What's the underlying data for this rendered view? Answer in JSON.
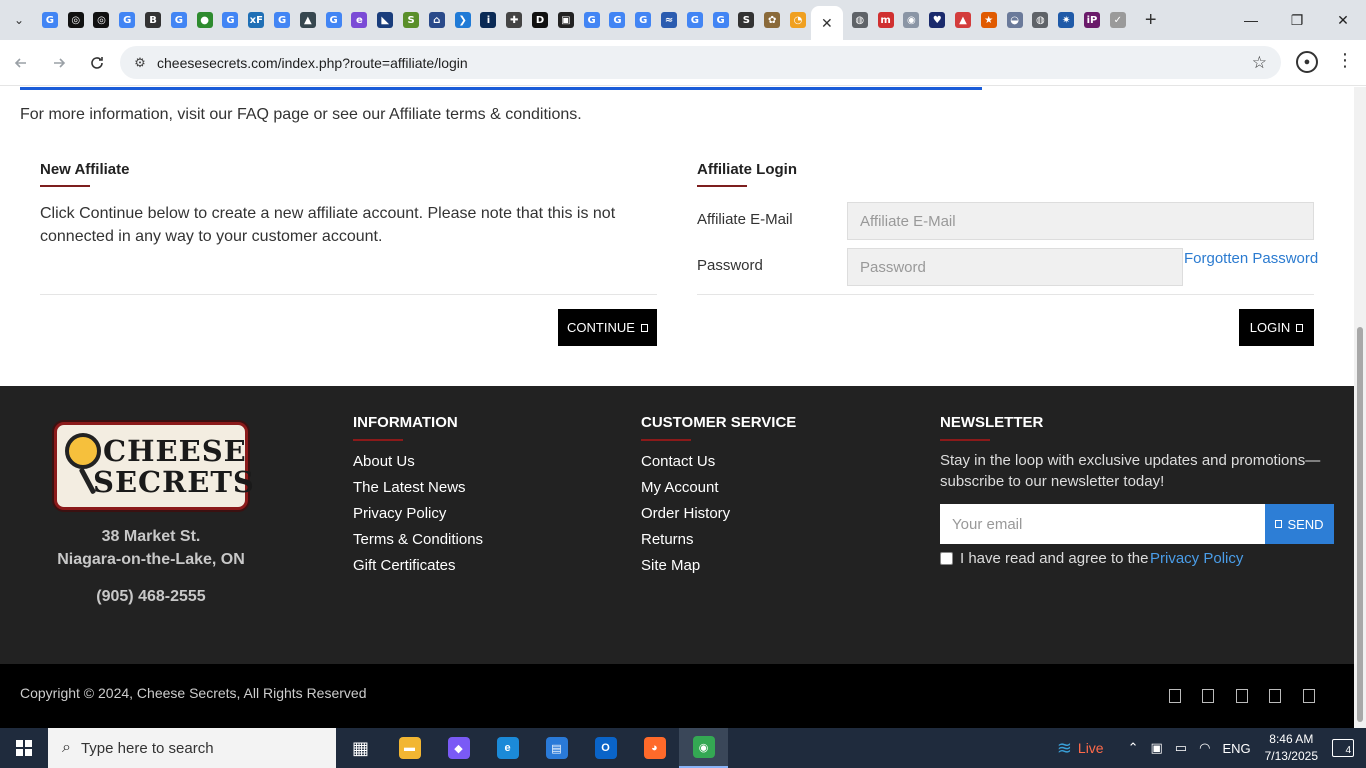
{
  "browser": {
    "url": "cheesesecrets.com/index.php?route=affiliate/login",
    "tab_close": "✕",
    "new_tab": "+",
    "window_controls": {
      "minimize": "—",
      "restore": "❐",
      "close": "✕"
    },
    "tab_favicons": [
      {
        "icon": "google-icon",
        "glyph": "G",
        "color": "#4285f4"
      },
      {
        "icon": "openai-icon",
        "glyph": "◎",
        "color": "#111111"
      },
      {
        "icon": "openai-icon",
        "glyph": "◎",
        "color": "#111111"
      },
      {
        "icon": "google-icon",
        "glyph": "G",
        "color": "#4285f4"
      },
      {
        "icon": "b-icon",
        "glyph": "B",
        "color": "#333333"
      },
      {
        "icon": "google-icon",
        "glyph": "G",
        "color": "#4285f4"
      },
      {
        "icon": "globe-icon",
        "glyph": "●",
        "color": "#2e8b2e"
      },
      {
        "icon": "google-icon",
        "glyph": "G",
        "color": "#4285f4"
      },
      {
        "icon": "xf-icon",
        "glyph": "xF",
        "color": "#1f6fb5"
      },
      {
        "icon": "google-icon",
        "glyph": "G",
        "color": "#4285f4"
      },
      {
        "icon": "cap-icon",
        "glyph": "▲",
        "color": "#37474f"
      },
      {
        "icon": "google-icon",
        "glyph": "G",
        "color": "#4285f4"
      },
      {
        "icon": "e-icon",
        "glyph": "e",
        "color": "#7b4bd6"
      },
      {
        "icon": "chart-icon",
        "glyph": "◣",
        "color": "#1a3d7c"
      },
      {
        "icon": "smart-icon",
        "glyph": "S",
        "color": "#5a8f2a"
      },
      {
        "icon": "bank-icon",
        "glyph": "⌂",
        "color": "#2a4a8a"
      },
      {
        "icon": "bird-icon",
        "glyph": "❯",
        "color": "#1f7ad6"
      },
      {
        "icon": "ibm-icon",
        "glyph": "i",
        "color": "#0a2a55"
      },
      {
        "icon": "caduceus-icon",
        "glyph": "✚",
        "color": "#444444"
      },
      {
        "icon": "dictionary-icon",
        "glyph": "D",
        "color": "#111111"
      },
      {
        "icon": "box-icon",
        "glyph": "▣",
        "color": "#222222"
      },
      {
        "icon": "google-icon",
        "glyph": "G",
        "color": "#4285f4"
      },
      {
        "icon": "google-icon",
        "glyph": "G",
        "color": "#4285f4"
      },
      {
        "icon": "google-icon",
        "glyph": "G",
        "color": "#4285f4"
      },
      {
        "icon": "wave-icon",
        "glyph": "≈",
        "color": "#2b5cb0"
      },
      {
        "icon": "google-icon",
        "glyph": "G",
        "color": "#4285f4"
      },
      {
        "icon": "google-icon",
        "glyph": "G",
        "color": "#4285f4"
      },
      {
        "icon": "sig-icon",
        "glyph": "S",
        "color": "#333333"
      },
      {
        "icon": "pattern-icon",
        "glyph": "✿",
        "color": "#8a6a3a"
      },
      {
        "icon": "cheese-icon",
        "glyph": "◔",
        "color": "#f0a020"
      }
    ],
    "tab_favicons_right": [
      {
        "icon": "globe-icon",
        "glyph": "◍",
        "color": "#5f6368"
      },
      {
        "icon": "m-icon",
        "glyph": "m",
        "color": "#d03030"
      },
      {
        "icon": "helmet-icon",
        "glyph": "◉",
        "color": "#8a95a5"
      },
      {
        "icon": "shield-icon",
        "glyph": "♥",
        "color": "#1a2a6c"
      },
      {
        "icon": "santa-icon",
        "glyph": "▲",
        "color": "#d33c3c"
      },
      {
        "icon": "badge-icon",
        "glyph": "★",
        "color": "#e05a00"
      },
      {
        "icon": "car-icon",
        "glyph": "◒",
        "color": "#6a7a9a"
      },
      {
        "icon": "globe-icon",
        "glyph": "◍",
        "color": "#5f6368"
      },
      {
        "icon": "gear-icon",
        "glyph": "✷",
        "color": "#1f5aa8"
      },
      {
        "icon": "ip-icon",
        "glyph": "iP",
        "color": "#6a1a6a"
      },
      {
        "icon": "check-icon",
        "glyph": "✓",
        "color": "#9a9a9a"
      }
    ]
  },
  "page": {
    "info_text": "For more information, visit our FAQ page or see our Affiliate terms & conditions.",
    "new_affiliate": {
      "heading": "New Affiliate",
      "text": "Click Continue below to create a new affiliate account. Please note that this is not connected in any way to your customer account.",
      "button": "CONTINUE"
    },
    "login": {
      "heading": "Affiliate Login",
      "email_label": "Affiliate E-Mail",
      "email_placeholder": "Affiliate E-Mail",
      "password_label": "Password",
      "password_placeholder": "Password",
      "forgotten": "Forgotten Password",
      "button": "LOGIN"
    }
  },
  "footer": {
    "logo_line1": "CHEESE",
    "logo_line2": "SECRETS",
    "address_line1": "38 Market St.",
    "address_line2": "Niagara-on-the-Lake, ON",
    "phone": "(905) 468-2555",
    "information": {
      "heading": "INFORMATION",
      "links": [
        "About Us",
        "The Latest News",
        "Privacy Policy",
        "Terms & Conditions",
        "Gift Certificates"
      ]
    },
    "customer_service": {
      "heading": "CUSTOMER SERVICE",
      "links": [
        "Contact Us",
        "My Account",
        "Order History",
        "Returns",
        "Site Map"
      ]
    },
    "newsletter": {
      "heading": "NEWSLETTER",
      "text": "Stay in the loop with exclusive updates and promotions—subscribe to our newsletter today!",
      "email_placeholder": "Your email",
      "send": "SEND",
      "agree_text": "I have read and agree to the",
      "policy_link": "Privacy Policy"
    },
    "copyright": "Copyright © 2024, Cheese Secrets, All Rights Reserved"
  },
  "taskbar": {
    "search_placeholder": "Type here to search",
    "apps": [
      {
        "name": "task-view-icon",
        "glyph": "▦",
        "color": "transparent"
      },
      {
        "name": "file-explorer-icon",
        "glyph": "▬",
        "color": "#f2b632"
      },
      {
        "name": "copilot-icon",
        "glyph": "◆",
        "color": "#7a5af5"
      },
      {
        "name": "edge-icon",
        "glyph": "e",
        "color": "#1b8ad8"
      },
      {
        "name": "store-icon",
        "glyph": "▤",
        "color": "#2a7ad8"
      },
      {
        "name": "outlook-icon",
        "glyph": "O",
        "color": "#0a64c8"
      },
      {
        "name": "firefox-icon",
        "glyph": "◕",
        "color": "#ff6a2a"
      },
      {
        "name": "chrome-icon",
        "glyph": "◉",
        "color": "#34a853"
      }
    ],
    "live": "Live",
    "language": "ENG",
    "time": "8:46 AM",
    "date": "7/13/2025",
    "notifications": "4"
  }
}
